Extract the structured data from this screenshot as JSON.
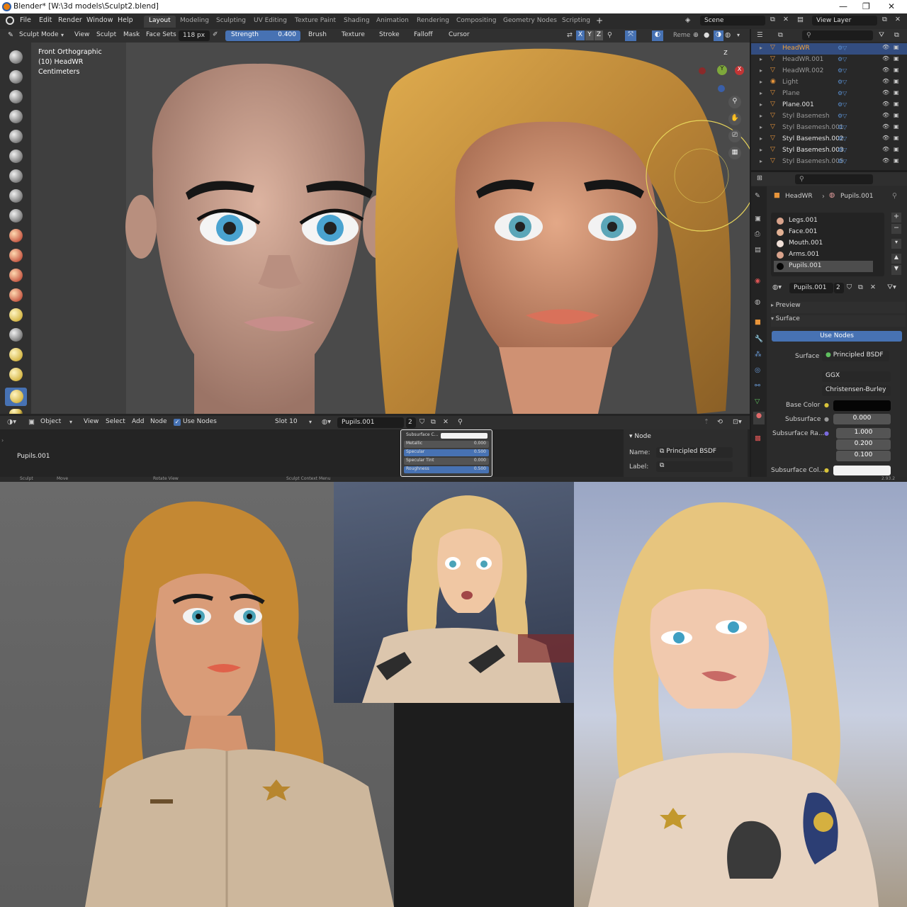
{
  "titlebar": {
    "title": "Blender* [W:\\3d models\\Sculpt2.blend]"
  },
  "topbar": {
    "menus": [
      "File",
      "Edit",
      "Render",
      "Window",
      "Help"
    ],
    "workspaces": [
      "Layout",
      "Modeling",
      "Sculpting",
      "UV Editing",
      "Texture Paint",
      "Shading",
      "Animation",
      "Rendering",
      "Compositing",
      "Geometry Nodes",
      "Scripting"
    ],
    "add_tab": "+",
    "scene": "Scene",
    "view_layer": "View Layer"
  },
  "viewport_header": {
    "mode": "Sculpt Mode",
    "menus": [
      "View",
      "Sculpt",
      "Mask",
      "Face Sets"
    ],
    "radius": "118 px",
    "strength_label": "Strength",
    "strength_value": "0.400",
    "dropdowns": [
      "Brush",
      "Texture",
      "Stroke",
      "Falloff",
      "Cursor"
    ],
    "axes": [
      "X",
      "Y",
      "Z"
    ],
    "overlay_text": "Reme"
  },
  "viewport": {
    "line1": "Front Orthographic",
    "line2": "(10) HeadWR",
    "line3": "Centimeters",
    "gizmo": {
      "z": "Z",
      "y": "Y",
      "x": "X"
    }
  },
  "outliner": {
    "items": [
      {
        "name": "HeadWR",
        "state": "selected"
      },
      {
        "name": "HeadWR.001",
        "state": "dim"
      },
      {
        "name": "HeadWR.002",
        "state": "dim"
      },
      {
        "name": "Light",
        "state": "dim"
      },
      {
        "name": "Plane",
        "state": "dim"
      },
      {
        "name": "Plane.001",
        "state": "bright"
      },
      {
        "name": "Styl Basemesh",
        "state": "dim"
      },
      {
        "name": "Styl Basemesh.001",
        "state": "dim"
      },
      {
        "name": "Styl Basemesh.002",
        "state": "bright"
      },
      {
        "name": "Styl Basemesh.003",
        "state": "bright"
      },
      {
        "name": "Styl Basemesh.005",
        "state": "dim"
      }
    ]
  },
  "properties": {
    "object": "HeadWR",
    "material": "Pupils.001",
    "slots": [
      "Legs.001",
      "Face.001",
      "Mouth.001",
      "Arms.001",
      "Pupils.001"
    ],
    "material_field": "Pupils.001",
    "user_count": "2",
    "preview": "Preview",
    "surface_section": "Surface",
    "use_nodes": "Use Nodes",
    "surface_label": "Surface",
    "surface_value": "Principled BSDF",
    "distribution": "GGX",
    "sss_method": "Christensen-Burley",
    "base_color_label": "Base Color",
    "base_color": "#050505",
    "subsurface_label": "Subsurface",
    "subsurface_value": "0.000",
    "subsurface_radius_label": "Subsurface Ra...",
    "subsurface_radius": [
      "1.000",
      "0.200",
      "0.100"
    ],
    "subsurface_color_label": "Subsurface Col...",
    "subsurface_color": "#f2f2f2"
  },
  "shader_editor": {
    "object_menu": "Object",
    "menus": [
      "View",
      "Select",
      "Add",
      "Node"
    ],
    "use_nodes": "Use Nodes",
    "slot": "Slot 10",
    "material": "Pupils.001",
    "user_count": "2",
    "breadcrumb": "Pupils.001",
    "node_fields": [
      {
        "label": "Subsurface C...",
        "value": "",
        "kind": "white"
      },
      {
        "label": "Metallic",
        "value": "0.000",
        "kind": "grey"
      },
      {
        "label": "Specular",
        "value": "0.500",
        "kind": "blue"
      },
      {
        "label": "Specular Tint",
        "value": "0.000",
        "kind": "grey"
      },
      {
        "label": "Roughness",
        "value": "0.500",
        "kind": "blue"
      }
    ],
    "npanel": {
      "title": "Node",
      "name_label": "Name:",
      "name_value": "Principled BSDF",
      "label_label": "Label:",
      "label_value": ""
    }
  },
  "status_bar": {
    "left": "Sculpt",
    "move": "Move",
    "rotate": "Rotate View",
    "context": "Sculpt Context Menu",
    "version": "2.93.2"
  },
  "colors": {
    "accent": "#4772b3",
    "selected_orange": "#f0a13a",
    "hair": "#c88c38",
    "skin": "#d8a88a"
  }
}
